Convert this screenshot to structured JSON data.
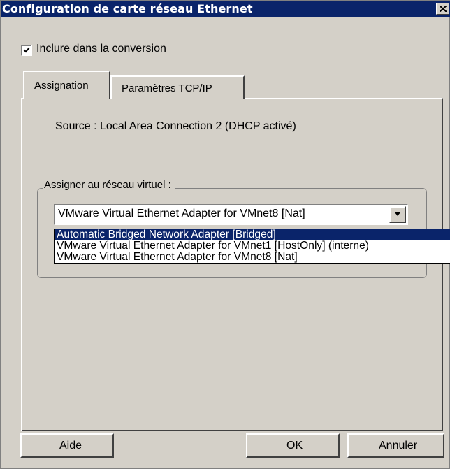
{
  "window": {
    "title": "Configuration de carte réseau Ethernet",
    "close_icon": "close-icon"
  },
  "include": {
    "label": "Inclure dans la conversion",
    "checked": true
  },
  "tabs": [
    {
      "label": "Assignation",
      "active": true
    },
    {
      "label": "Paramètres TCP/IP",
      "active": false
    }
  ],
  "assignation": {
    "source_text": "Source :  Local Area Connection 2 (DHCP activé)",
    "group_title": "Assigner au réseau virtuel :",
    "select_value": "VMware Virtual Ethernet Adapter for VMnet8 [Nat]",
    "options": [
      "Automatic Bridged Network Adapter [Bridged]",
      "VMware Virtual Ethernet Adapter for VMnet1 [HostOnly] (interne)",
      "VMware Virtual Ethernet Adapter for VMnet8 [Nat]"
    ],
    "highlighted_option_index": 0
  },
  "buttons": {
    "help": "Aide",
    "ok": "OK",
    "cancel": "Annuler"
  },
  "colors": {
    "titlebar": "#0a246a",
    "face": "#d4d0c8",
    "highlight": "#0a246a"
  }
}
